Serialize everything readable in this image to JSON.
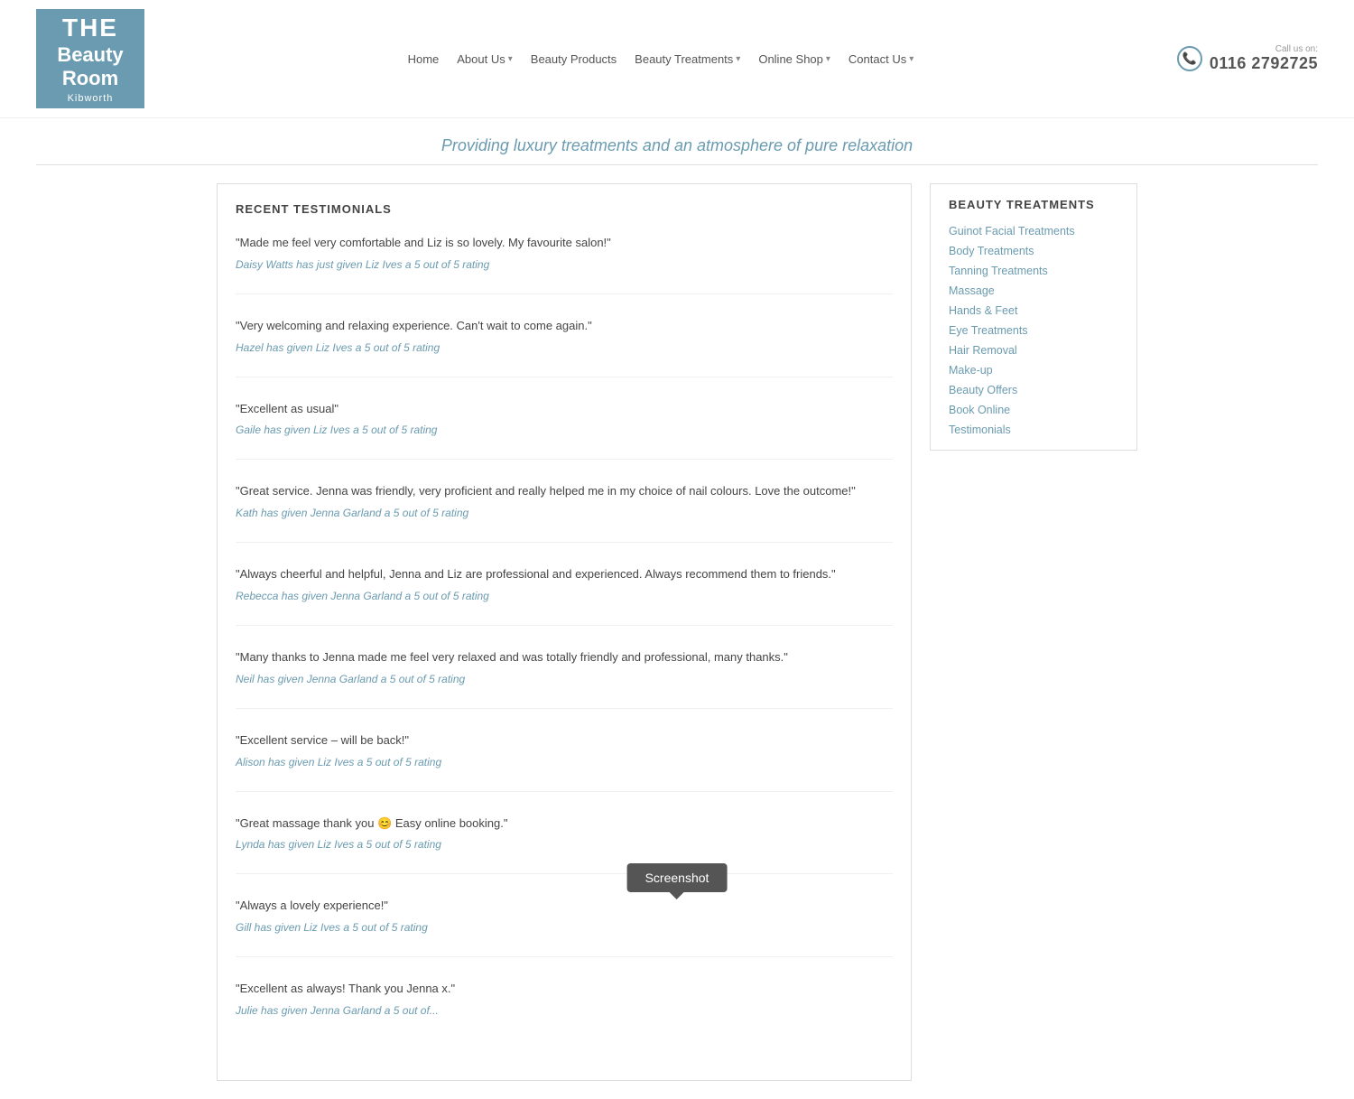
{
  "header": {
    "logo": {
      "the": "THE",
      "beauty": "Beauty",
      "room": "Room",
      "kibworth": "Kibworth"
    },
    "nav": {
      "home": "Home",
      "about_us": "About Us",
      "beauty_products": "Beauty Products",
      "beauty_treatments": "Beauty Treatments",
      "online_shop": "Online Shop",
      "contact_us": "Contact Us"
    },
    "phone": {
      "call_us_label": "Call us on:",
      "number": "0116 2792725"
    }
  },
  "tagline": "Providing luxury treatments and an atmosphere of pure relaxation",
  "testimonials": {
    "section_title": "RECENT TESTIMONIALS",
    "items": [
      {
        "quote": "\"Made me feel very comfortable and Liz is so lovely. My favourite salon!\"",
        "rating": "Daisy Watts has just given Liz Ives a 5 out of 5 rating"
      },
      {
        "quote": "\"Very welcoming and relaxing experience. Can't wait to come again.\"",
        "rating": "Hazel has given Liz Ives a 5 out of 5 rating"
      },
      {
        "quote": "\"Excellent as usual\"",
        "rating": "Gaile has given Liz Ives a 5 out of 5 rating"
      },
      {
        "quote": "\"Great service. Jenna was friendly, very proficient and really helped me in my choice of nail colours. Love the outcome!\"",
        "rating": "Kath has given Jenna Garland a 5 out of 5 rating"
      },
      {
        "quote": "\"Always cheerful and helpful, Jenna and Liz are professional and experienced. Always recommend them to friends.\"",
        "rating": "Rebecca has given Jenna Garland a 5 out of 5 rating"
      },
      {
        "quote": "\"Many thanks to Jenna made me feel very relaxed and was totally friendly and professional, many thanks.\"",
        "rating": "Neil has given Jenna Garland a 5 out of 5 rating"
      },
      {
        "quote": "\"Excellent service – will be back!\"",
        "rating": "Alison has given Liz Ives a 5 out of 5 rating"
      },
      {
        "quote": "\"Great massage thank you 😊 Easy online booking.\"",
        "rating": "Lynda has given Liz Ives a 5 out of 5 rating"
      },
      {
        "quote": "\"Always a lovely experience!\"",
        "rating": "Gill has given Liz Ives a 5 out of 5 rating"
      },
      {
        "quote": "\"Excellent as always! Thank you Jenna x.\"",
        "rating": "Julie has given Jenna Garland a 5 out of..."
      }
    ]
  },
  "sidebar": {
    "title": "BEAUTY TREATMENTS",
    "links": [
      "Guinot Facial Treatments",
      "Body Treatments",
      "Tanning Treatments",
      "Massage",
      "Hands & Feet",
      "Eye Treatments",
      "Hair Removal",
      "Make-up",
      "Beauty Offers",
      "Book Online",
      "Testimonials"
    ]
  },
  "screenshot_badge": "Screenshot"
}
